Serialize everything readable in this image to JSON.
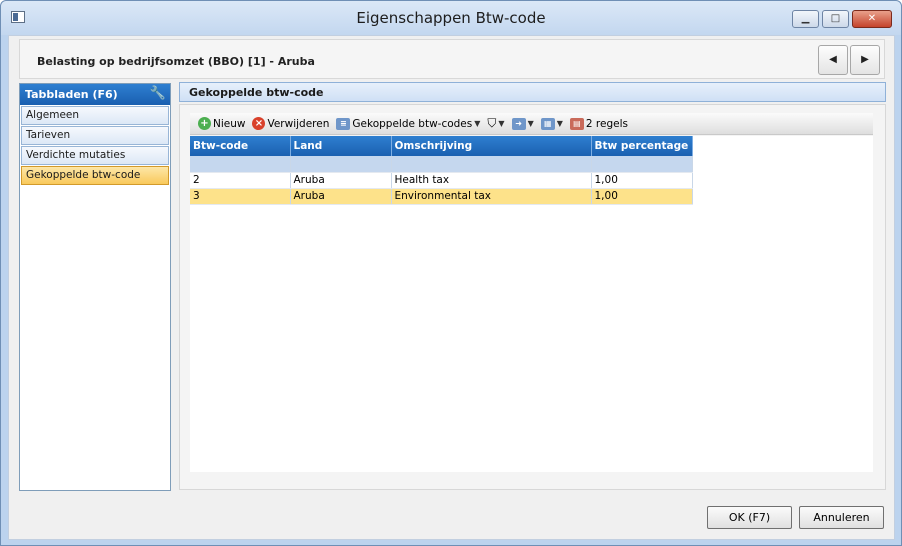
{
  "window": {
    "title": "Eigenschappen Btw-code"
  },
  "header": {
    "title": "Belasting op bedrijfsomzet (BBO) [1] - Aruba"
  },
  "sidebar": {
    "title": "Tabbladen (F6)",
    "items": [
      {
        "label": "Algemeen"
      },
      {
        "label": "Tarieven"
      },
      {
        "label": "Verdichte mutaties"
      },
      {
        "label": "Gekoppelde btw-code"
      }
    ]
  },
  "panel": {
    "title": "Gekoppelde btw-code"
  },
  "toolbar": {
    "new_label": "Nieuw",
    "delete_label": "Verwijderen",
    "linked_label": "Gekoppelde btw-codes",
    "count_label": "2 regels"
  },
  "table": {
    "headers": [
      "Btw-code",
      "Land",
      "Omschrijving",
      "Btw percentage"
    ],
    "rows": [
      [
        "2",
        "Aruba",
        "Health tax",
        "1,00"
      ],
      [
        "3",
        "Aruba",
        "Environmental tax",
        "1,00"
      ]
    ]
  },
  "footer": {
    "ok_label": "OK (F7)",
    "cancel_label": "Annuleren"
  }
}
